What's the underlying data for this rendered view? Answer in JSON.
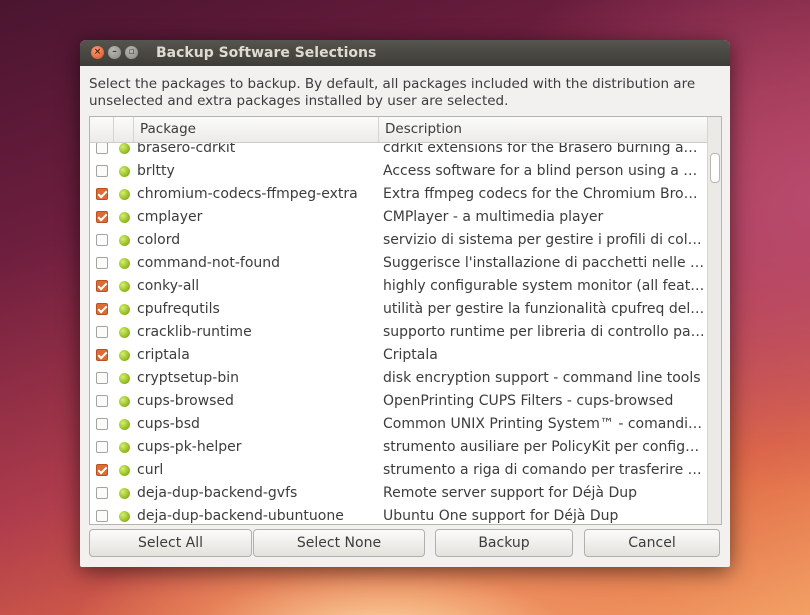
{
  "window": {
    "title": "Backup Software Selections",
    "description": "Select the packages to backup. By default, all packages included with the distribution are unselected and extra packages installed by user are selected."
  },
  "table": {
    "columns": [
      "Package",
      "Description"
    ],
    "rows": [
      {
        "checked": false,
        "package": "brasero-cdrkit",
        "description": "cdrkit extensions for the Brasero burning app..."
      },
      {
        "checked": false,
        "package": "brltty",
        "description": "Access software for a blind person using a br..."
      },
      {
        "checked": true,
        "package": "chromium-codecs-ffmpeg-extra",
        "description": "Extra ffmpeg codecs for the Chromium Browser"
      },
      {
        "checked": true,
        "package": "cmplayer",
        "description": "CMPlayer - a multimedia player"
      },
      {
        "checked": false,
        "package": "colord",
        "description": "servizio di sistema per gestire i profili di color..."
      },
      {
        "checked": false,
        "package": "command-not-found",
        "description": "Suggerisce l'installazione di pacchetti nelle se..."
      },
      {
        "checked": true,
        "package": "conky-all",
        "description": "highly configurable system monitor (all featur..."
      },
      {
        "checked": true,
        "package": "cpufrequtils",
        "description": "utilità per gestire la funzionalità cpufreq del k..."
      },
      {
        "checked": false,
        "package": "cracklib-runtime",
        "description": "supporto runtime per libreria di controllo pas..."
      },
      {
        "checked": true,
        "package": "criptala",
        "description": "Criptala"
      },
      {
        "checked": false,
        "package": "cryptsetup-bin",
        "description": "disk encryption support - command line tools"
      },
      {
        "checked": false,
        "package": "cups-browsed",
        "description": "OpenPrinting CUPS Filters - cups-browsed"
      },
      {
        "checked": false,
        "package": "cups-bsd",
        "description": "Common UNIX Printing System™ - comandi BSD"
      },
      {
        "checked": false,
        "package": "cups-pk-helper",
        "description": "strumento ausiliare per PolicyKit per configur..."
      },
      {
        "checked": true,
        "package": "curl",
        "description": "strumento a riga di comando per trasferire d..."
      },
      {
        "checked": false,
        "package": "deja-dup-backend-gvfs",
        "description": "Remote server support for Déjà Dup"
      },
      {
        "checked": false,
        "package": "deja-dup-backend-ubuntuone",
        "description": "Ubuntu One support for Déjà Dup"
      }
    ]
  },
  "buttons": {
    "select_all": "Select All",
    "select_none": "Select None",
    "backup": "Backup",
    "cancel": "Cancel"
  },
  "icons": {
    "close": "close-icon",
    "minimize": "minimize-icon",
    "maximize": "maximize-icon",
    "status": "installed-status-icon"
  }
}
